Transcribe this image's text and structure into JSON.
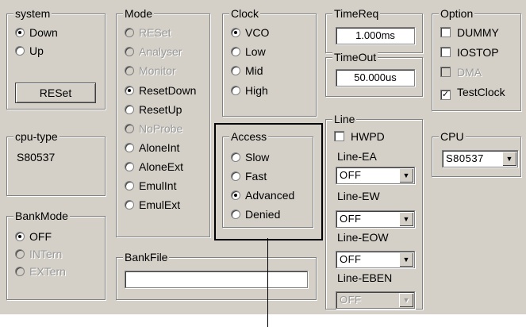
{
  "system": {
    "legend": "system",
    "options": [
      {
        "label": "Down",
        "selected": true
      },
      {
        "label": "Up",
        "selected": false
      }
    ],
    "reset_button": "RESet"
  },
  "cpu_type": {
    "legend": "cpu-type",
    "value": "S80537"
  },
  "bank_mode": {
    "legend": "BankMode",
    "options": [
      {
        "label": "OFF",
        "selected": true,
        "disabled": false
      },
      {
        "label": "INTern",
        "selected": false,
        "disabled": true
      },
      {
        "label": "EXTern",
        "selected": false,
        "disabled": true
      }
    ]
  },
  "mode": {
    "legend": "Mode",
    "options": [
      {
        "label": "RESet",
        "selected": false,
        "disabled": true
      },
      {
        "label": "Analyser",
        "selected": false,
        "disabled": true
      },
      {
        "label": "Monitor",
        "selected": false,
        "disabled": true
      },
      {
        "label": "ResetDown",
        "selected": true,
        "disabled": false
      },
      {
        "label": "ResetUp",
        "selected": false,
        "disabled": false
      },
      {
        "label": "NoProbe",
        "selected": false,
        "disabled": true
      },
      {
        "label": "AloneInt",
        "selected": false,
        "disabled": false
      },
      {
        "label": "AloneExt",
        "selected": false,
        "disabled": false
      },
      {
        "label": "EmulInt",
        "selected": false,
        "disabled": false
      },
      {
        "label": "EmulExt",
        "selected": false,
        "disabled": false
      }
    ]
  },
  "bank_file": {
    "legend": "BankFile",
    "value": ""
  },
  "clock": {
    "legend": "Clock",
    "options": [
      {
        "label": "VCO",
        "selected": true
      },
      {
        "label": "Low",
        "selected": false
      },
      {
        "label": "Mid",
        "selected": false
      },
      {
        "label": "High",
        "selected": false
      }
    ]
  },
  "access": {
    "legend": "Access",
    "options": [
      {
        "label": "Slow",
        "selected": false
      },
      {
        "label": "Fast",
        "selected": false
      },
      {
        "label": "Advanced",
        "selected": true
      },
      {
        "label": "Denied",
        "selected": false
      }
    ]
  },
  "time_req": {
    "legend": "TimeReq",
    "value": "1.000ms"
  },
  "time_out": {
    "legend": "TimeOut",
    "value": "50.000us"
  },
  "line": {
    "legend": "Line",
    "hwpd": {
      "label": "HWPD",
      "checked": false
    },
    "line_ea": {
      "label": "Line-EA",
      "value": "OFF"
    },
    "line_ew": {
      "label": "Line-EW",
      "value": "OFF"
    },
    "line_eow": {
      "label": "Line-EOW",
      "value": "OFF"
    },
    "line_eben": {
      "label": "Line-EBEN",
      "value": "OFF",
      "disabled": true
    }
  },
  "option": {
    "legend": "Option",
    "items": [
      {
        "label": "DUMMY",
        "checked": false,
        "disabled": false
      },
      {
        "label": "IOSTOP",
        "checked": false,
        "disabled": false
      },
      {
        "label": "DMA",
        "checked": false,
        "disabled": true
      },
      {
        "label": "TestClock",
        "checked": true,
        "disabled": false
      }
    ]
  },
  "cpu": {
    "legend": "CPU",
    "value": "S80537"
  },
  "icons": {
    "checkmark": "✓",
    "dropdown": "▼"
  }
}
